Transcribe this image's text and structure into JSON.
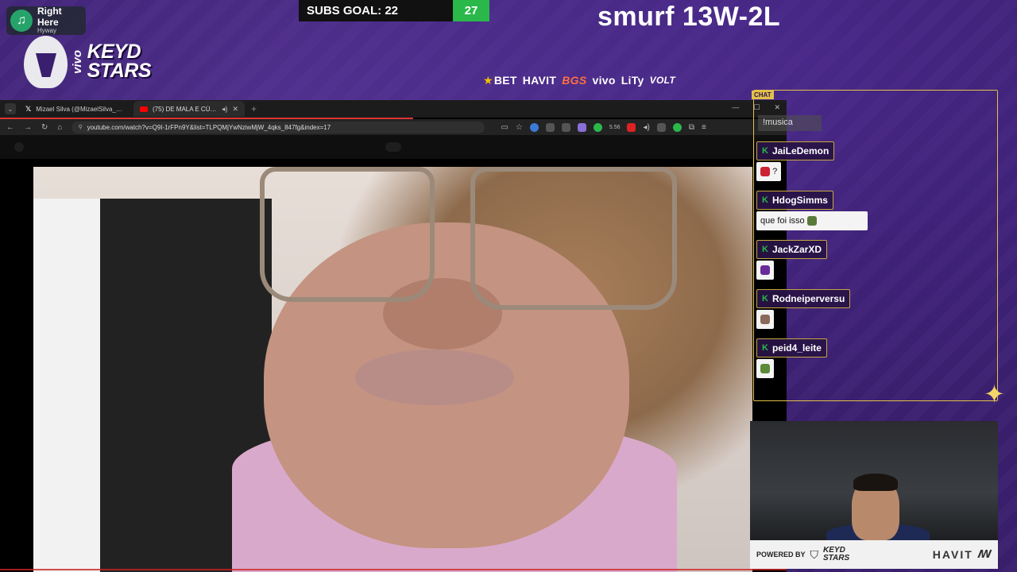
{
  "now_playing": {
    "title": "Right Here",
    "artist": "Hyway",
    "icon": "music-note-icon"
  },
  "subs_goal": {
    "label": "SUBS GOAL: 22",
    "count": "27",
    "accent": "#2ab84a"
  },
  "headline": "smurf 13W-2L",
  "team_logo": {
    "sponsor": "vivo",
    "words": [
      "KEYD",
      "STARS"
    ]
  },
  "sponsors": [
    "BET",
    "HAVIT",
    "BGS",
    "vivo",
    "LiTy",
    "VOLT"
  ],
  "browser": {
    "tabs": [
      {
        "label": "Mizael Silva (@MizaelSilva_) / X",
        "icon": "x-logo-icon",
        "active": false
      },
      {
        "label": "(75) DE MALA E CÚIA EM IT",
        "icon": "youtube-icon",
        "active": true
      }
    ],
    "url": "youtube.com/watch?v=Q9I-1rFPn9Y&list=TLPQMjYwNziwMjW_4qks_847fg&index=17",
    "extension_badge": "5.56"
  },
  "chat": {
    "header_tag": "CHAT",
    "search_text": "!musica",
    "messages": [
      {
        "user": "JaiLeDemon",
        "text": "?"
      },
      {
        "user": "HdogSimms",
        "text": "que foi isso"
      },
      {
        "user": "JackZarXD",
        "text": ""
      },
      {
        "user": "Rodneiperversu",
        "text": ""
      },
      {
        "user": "peid4_leite",
        "text": ""
      }
    ],
    "badge": "K",
    "border_color": "#e2c04a"
  },
  "webcam": {
    "powered_label": "POWERED BY",
    "powered_team": [
      "KEYD",
      "STARS"
    ],
    "powered_havit": "HAVIT"
  }
}
